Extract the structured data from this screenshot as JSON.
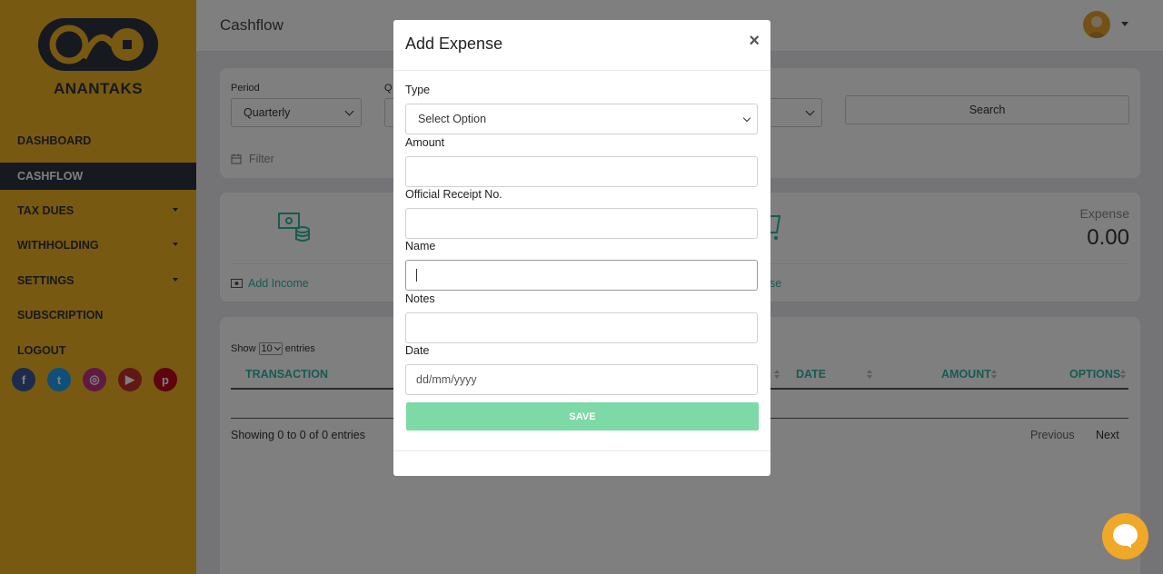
{
  "sidebar": {
    "brand": "ANANTAKS",
    "items": [
      {
        "label": "DASHBOARD"
      },
      {
        "label": "CASHFLOW"
      },
      {
        "label": "TAX DUES"
      },
      {
        "label": "WITHHOLDING"
      },
      {
        "label": "SETTINGS"
      },
      {
        "label": "SUBSCRIPTION"
      },
      {
        "label": "LOGOUT"
      }
    ],
    "socials": [
      "facebook-icon",
      "twitter-icon",
      "instagram-icon",
      "youtube-icon",
      "pinterest-icon"
    ]
  },
  "header": {
    "title": "Cashflow"
  },
  "filters": {
    "period_label": "Period",
    "period_value": "Quarterly",
    "quarter_label_fragment": "Q",
    "search_label": "Search",
    "filter_label": "Filter"
  },
  "summary": {
    "add_income_label": "Add Income",
    "add_expense_fragment": "se",
    "expense_label": "Expense",
    "expense_value": "0.00"
  },
  "table": {
    "show_label": "Show",
    "entries_select": "10",
    "entries_label": "entries",
    "columns": [
      "TRANSACTION",
      "DATE",
      "AMOUNT",
      "OPTIONS"
    ],
    "info": "Showing 0 to 0 of 0 entries",
    "previous_label": "Previous",
    "next_label": "Next"
  },
  "modal": {
    "title": "Add Expense",
    "close_glyph": "×",
    "type_label": "Type",
    "type_value": "Select Option",
    "amount_label": "Amount",
    "amount_value": "",
    "receipt_label": "Official Receipt No.",
    "receipt_value": "",
    "name_label": "Name",
    "name_value": "",
    "notes_label": "Notes",
    "notes_value": "",
    "date_label": "Date",
    "date_placeholder": "dd/mm/yyyy",
    "save_label": "SAVE"
  },
  "colors": {
    "sidebar": "#f0b323",
    "sidebar_active": "#2c3340",
    "accent_teal": "#2fb7a3",
    "save_button": "#7dd9a6"
  }
}
